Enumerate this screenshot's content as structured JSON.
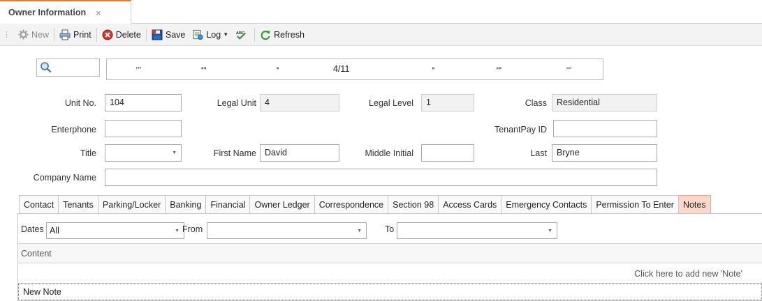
{
  "document_tab": {
    "title": "Owner Information",
    "close": "×"
  },
  "toolbar": {
    "new_label": "New",
    "print_label": "Print",
    "delete_label": "Delete",
    "save_label": "Save",
    "log_label": "Log",
    "refresh_label": "Refresh"
  },
  "navigator": {
    "first": "⏮",
    "prev_page": "◂◂",
    "prev": "◂",
    "position": "4/11",
    "next": "▸",
    "next_page": "▸▸",
    "last": "⏭"
  },
  "form": {
    "unit_no_label": "Unit No.",
    "unit_no_value": "104",
    "legal_unit_label": "Legal Unit",
    "legal_unit_value": "4",
    "legal_level_label": "Legal Level",
    "legal_level_value": "1",
    "class_label": "Class",
    "class_value": "Residential",
    "enterphone_label": "Enterphone",
    "enterphone_value": "",
    "tenantpay_label": "TenantPay ID",
    "tenantpay_value": "",
    "title_label": "Title",
    "title_value": "",
    "first_name_label": "First Name",
    "first_name_value": "David",
    "middle_initial_label": "Middle Initial",
    "middle_initial_value": "",
    "last_label": "Last",
    "last_value": "Bryne",
    "company_name_label": "Company Name",
    "company_name_value": ""
  },
  "tabs": [
    "Contact",
    "Tenants",
    "Parking/Locker",
    "Banking",
    "Financial",
    "Owner Ledger",
    "Correspondence",
    "Section 98",
    "Access Cards",
    "Emergency Contacts",
    "Permission To Enter",
    "Notes"
  ],
  "notes": {
    "dates_label": "Dates",
    "dates_value": "All",
    "from_label": "From",
    "from_value": "",
    "to_label": "To",
    "to_value": "",
    "column_content": "Content",
    "add_hint": "Click here to add new 'Note'",
    "new_row": "New Note"
  },
  "colors": {
    "active_tab": "#fbd8cc",
    "doc_tab_accent": "#e87a2a"
  }
}
